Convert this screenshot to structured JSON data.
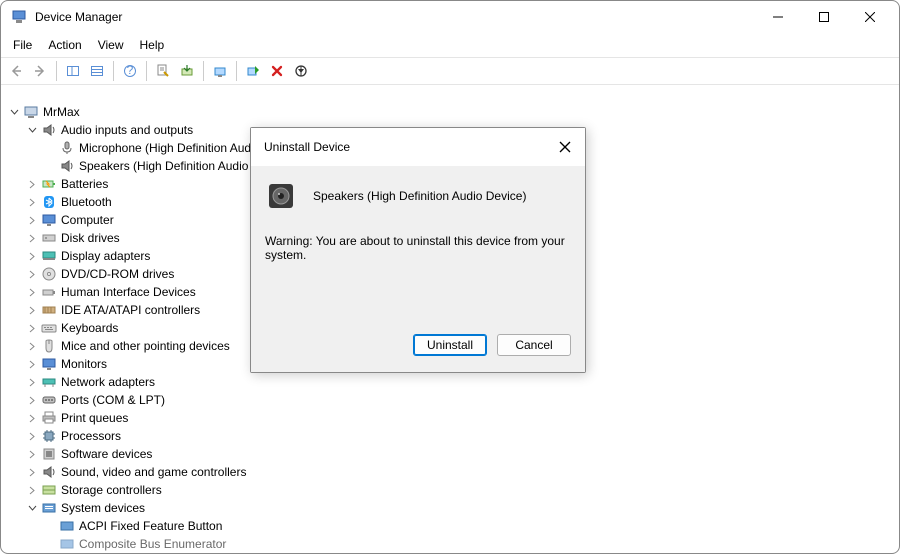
{
  "window": {
    "title": "Device Manager"
  },
  "menu": {
    "file": "File",
    "action": "Action",
    "view": "View",
    "help": "Help"
  },
  "tree": {
    "root": "MrMax",
    "audio": "Audio inputs and outputs",
    "mic": "Microphone (High Definition Audio Device)",
    "speakers": "Speakers (High Definition Audio Device)",
    "batteries": "Batteries",
    "bluetooth": "Bluetooth",
    "computer": "Computer",
    "disk": "Disk drives",
    "display": "Display adapters",
    "dvd": "DVD/CD-ROM drives",
    "hid": "Human Interface Devices",
    "ide": "IDE ATA/ATAPI controllers",
    "keyboards": "Keyboards",
    "mice": "Mice and other pointing devices",
    "monitors": "Monitors",
    "network": "Network adapters",
    "ports": "Ports (COM & LPT)",
    "print": "Print queues",
    "processors": "Processors",
    "software": "Software devices",
    "sound": "Sound, video and game controllers",
    "storage": "Storage controllers",
    "system": "System devices",
    "acpi": "ACPI Fixed Feature Button",
    "composite": "Composite Bus Enumerator"
  },
  "dialog": {
    "title": "Uninstall Device",
    "device": "Speakers (High Definition Audio Device)",
    "warning": "Warning: You are about to uninstall this device from your system.",
    "uninstall": "Uninstall",
    "cancel": "Cancel"
  }
}
